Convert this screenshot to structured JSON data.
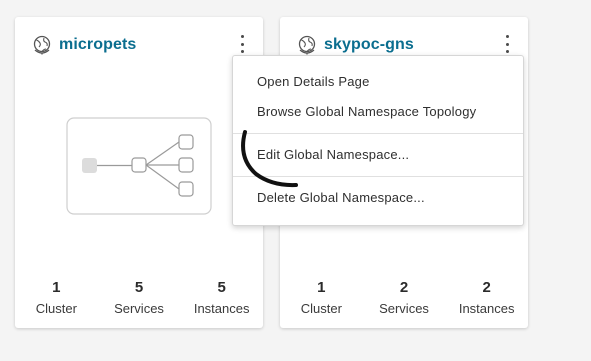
{
  "cards": [
    {
      "title": "micropets",
      "icon": "globe-icon",
      "stats": [
        {
          "value": "1",
          "label": "Cluster"
        },
        {
          "value": "5",
          "label": "Services"
        },
        {
          "value": "5",
          "label": "Instances"
        }
      ]
    },
    {
      "title": "skypoc-gns",
      "icon": "globe-icon",
      "stats": [
        {
          "value": "1",
          "label": "Cluster"
        },
        {
          "value": "2",
          "label": "Services"
        },
        {
          "value": "2",
          "label": "Instances"
        }
      ]
    }
  ],
  "menu": {
    "items": [
      "Open Details Page",
      "Browse Global Namespace Topology",
      "Edit Global Namespace...",
      "Delete Global Namespace..."
    ]
  },
  "colors": {
    "title": "#0b6e8f",
    "background": "#f4f4f4",
    "card": "#ffffff"
  }
}
